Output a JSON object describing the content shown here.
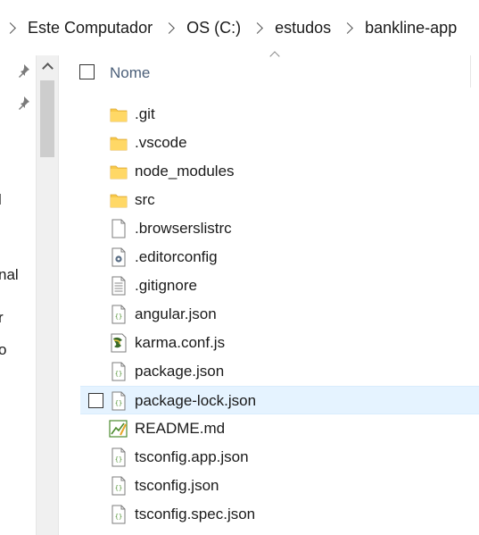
{
  "breadcrumb": [
    "Este Computador",
    "OS (C:)",
    "estudos",
    "bankline-app"
  ],
  "nav": {
    "partial_labels": [
      "l",
      "nal",
      "r",
      "o"
    ]
  },
  "header": {
    "name_label": "Nome"
  },
  "files": [
    {
      "name": ".git",
      "icon": "folder-icon",
      "type": "folder"
    },
    {
      "name": ".vscode",
      "icon": "folder-icon",
      "type": "folder"
    },
    {
      "name": "node_modules",
      "icon": "folder-icon",
      "type": "folder"
    },
    {
      "name": "src",
      "icon": "folder-icon",
      "type": "folder"
    },
    {
      "name": ".browserslistrc",
      "icon": "blank-file-icon",
      "type": "file"
    },
    {
      "name": ".editorconfig",
      "icon": "settings-file-icon",
      "type": "file"
    },
    {
      "name": ".gitignore",
      "icon": "text-file-icon",
      "type": "file"
    },
    {
      "name": "angular.json",
      "icon": "json-file-icon",
      "type": "file"
    },
    {
      "name": "karma.conf.js",
      "icon": "js-file-icon",
      "type": "file"
    },
    {
      "name": "package.json",
      "icon": "json-file-icon",
      "type": "file"
    },
    {
      "name": "package-lock.json",
      "icon": "json-file-icon",
      "type": "file",
      "hovered": true
    },
    {
      "name": "README.md",
      "icon": "markdown-file-icon",
      "type": "file"
    },
    {
      "name": "tsconfig.app.json",
      "icon": "json-file-icon",
      "type": "file"
    },
    {
      "name": "tsconfig.json",
      "icon": "json-file-icon",
      "type": "file"
    },
    {
      "name": "tsconfig.spec.json",
      "icon": "json-file-icon",
      "type": "file"
    }
  ],
  "colors": {
    "folder": "#f8c94a",
    "hover": "#e5f3ff",
    "header_text": "#4c607a"
  }
}
